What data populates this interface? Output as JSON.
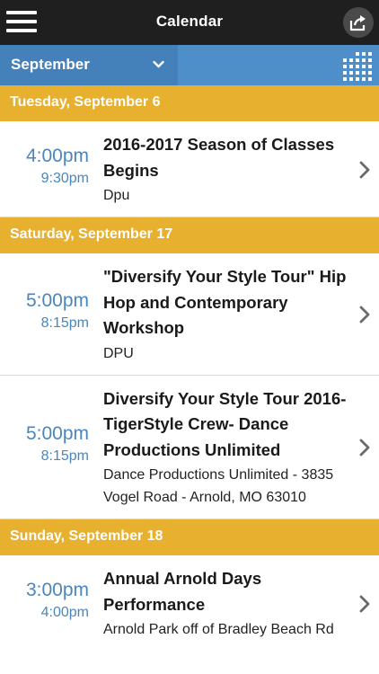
{
  "header": {
    "title": "Calendar",
    "menu_icon": "hamburger-menu-icon",
    "share_icon": "share-icon"
  },
  "month_bar": {
    "selected_month": "September",
    "dropdown_icon": "chevron-down-icon",
    "grid_icon": "calendar-grid-icon"
  },
  "colors": {
    "topbar": "#1f1f1f",
    "month_bar": "#4e8ec9",
    "month_select": "#4481bb",
    "day_header": "#e8b02f",
    "time_text": "#4a86be",
    "arrow": "#6a6a6a"
  },
  "days": [
    {
      "label": "Tuesday, September 6",
      "events": [
        {
          "start": "4:00pm",
          "end": "9:30pm",
          "title_lines": [
            "2016-2017 Season of Classes",
            "Begins"
          ],
          "location_lines": [
            "Dpu"
          ]
        }
      ]
    },
    {
      "label": "Saturday, September 17",
      "events": [
        {
          "start": "5:00pm",
          "end": "8:15pm",
          "title_lines": [
            "\"Diversify Your Style Tour\" Hip",
            "Hop and Contemporary",
            "Workshop"
          ],
          "location_lines": [
            "DPU"
          ]
        },
        {
          "start": "5:00pm",
          "end": "8:15pm",
          "title_lines": [
            "Diversify Your Style Tour 2016-",
            "TigerStyle Crew- Dance",
            "Productions Unlimited"
          ],
          "location_lines": [
            "Dance Productions Unlimited - 3835",
            "Vogel Road - Arnold, MO 63010"
          ]
        }
      ]
    },
    {
      "label": "Sunday, September 18",
      "events": [
        {
          "start": "3:00pm",
          "end": "4:00pm",
          "title_lines": [
            "Annual Arnold Days",
            "Performance"
          ],
          "location_lines": [
            "Arnold Park off of Bradley Beach Rd"
          ]
        }
      ]
    }
  ]
}
